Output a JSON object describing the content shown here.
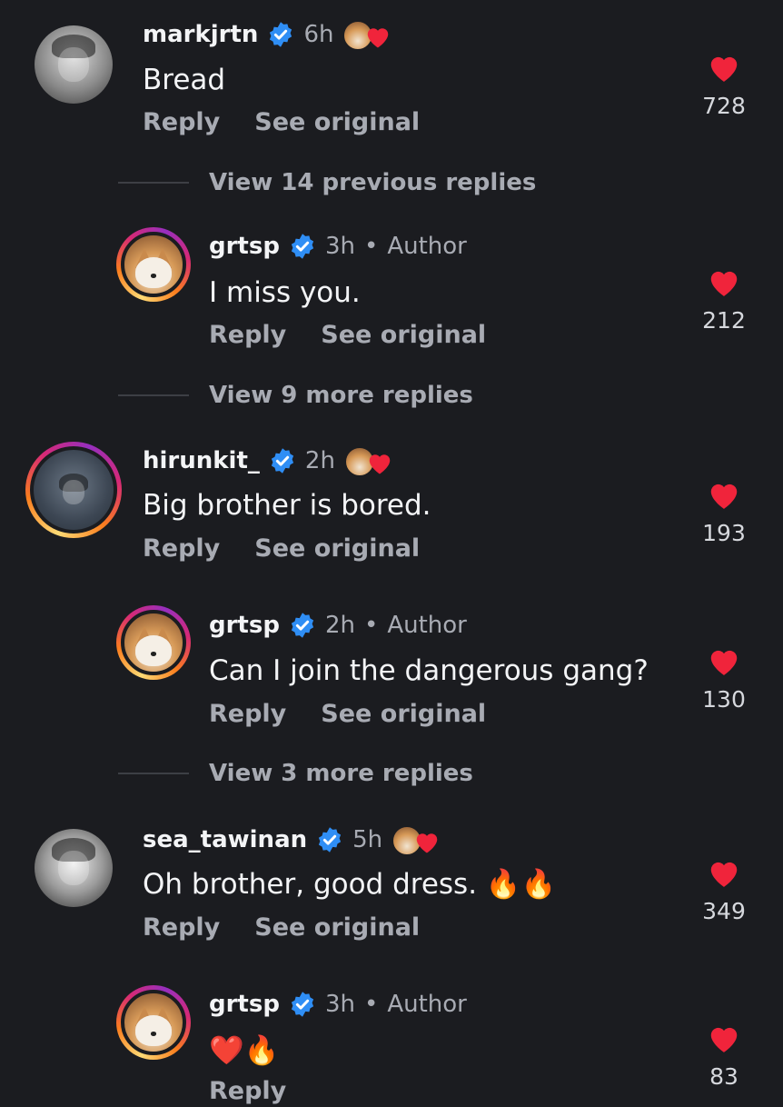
{
  "comments": [
    {
      "username": "markjrtn",
      "time": "6h",
      "text": "Bread",
      "reply": "Reply",
      "see_original": "See original",
      "likes": "728"
    },
    {
      "view_more": "View 14 previous replies"
    },
    {
      "username": "grtsp",
      "time": "3h",
      "dot": "•",
      "author": "Author",
      "text": "I miss you.",
      "reply": "Reply",
      "see_original": "See original",
      "likes": "212"
    },
    {
      "view_more": "View 9 more replies"
    },
    {
      "username": "hirunkit_",
      "time": "2h",
      "text": "Big brother is bored.",
      "reply": "Reply",
      "see_original": "See original",
      "likes": "193"
    },
    {
      "username": "grtsp",
      "time": "2h",
      "dot": "•",
      "author": "Author",
      "text": "Can I join the dangerous gang?",
      "reply": "Reply",
      "see_original": "See original",
      "likes": "130"
    },
    {
      "view_more": "View 3 more replies"
    },
    {
      "username": "sea_tawinan",
      "time": "5h",
      "text": "Oh brother, good dress. 🔥🔥",
      "reply": "Reply",
      "see_original": "See original",
      "likes": "349"
    },
    {
      "username": "grtsp",
      "time": "3h",
      "dot": "•",
      "author": "Author",
      "text": "❤️🔥",
      "reply": "Reply",
      "likes": "83"
    }
  ],
  "colors": {
    "background": "#1b1c20",
    "heart": "#f0243b",
    "verified": "#2f8ef5",
    "secondary_text": "#a8abb3"
  },
  "icons": {
    "verified": "verified-badge-icon",
    "like": "heart-icon",
    "fire": "fire-emoji-icon",
    "red_heart": "red-heart-emoji-icon"
  }
}
